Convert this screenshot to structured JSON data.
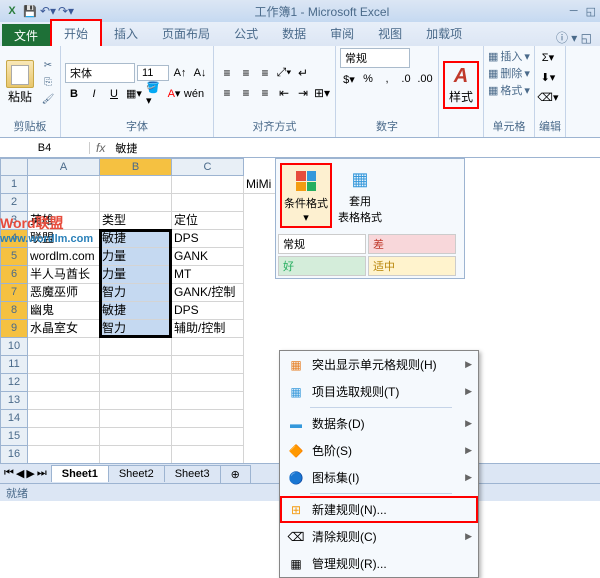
{
  "title": "工作簿1 - Microsoft Excel",
  "tabs": {
    "file": "文件",
    "home": "开始",
    "insert": "插入",
    "layout": "页面布局",
    "formulas": "公式",
    "data": "数据",
    "review": "审阅",
    "view": "视图",
    "addins": "加载项"
  },
  "ribbon": {
    "clipboard": {
      "label": "剪贴板",
      "paste": "粘贴"
    },
    "font": {
      "label": "字体",
      "name": "宋体",
      "size": "11"
    },
    "align": {
      "label": "对齐方式"
    },
    "number": {
      "label": "数字",
      "format": "常规"
    },
    "styles": {
      "label": "样式"
    },
    "cells": {
      "label": "单元格",
      "insert": "插入",
      "delete": "删除",
      "format": "格式"
    },
    "editing": {
      "label": "编辑"
    }
  },
  "namebox": "B4",
  "formula": "敏捷",
  "columns": [
    "A",
    "B",
    "C"
  ],
  "grid": [
    [
      "",
      "",
      "",
      "MiMi"
    ],
    [
      "",
      "",
      ""
    ],
    [
      "英雄",
      "类型",
      "定位"
    ],
    [
      "联盟",
      "敏捷",
      "DPS"
    ],
    [
      "wordlm.com",
      "力量",
      "GANK"
    ],
    [
      "半人马酋长",
      "力量",
      "MT"
    ],
    [
      "恶魔巫师",
      "智力",
      "GANK/控制"
    ],
    [
      "幽鬼",
      "敏捷",
      "DPS"
    ],
    [
      "水晶室女",
      "智力",
      "辅助/控制"
    ]
  ],
  "watermark": {
    "line1": "Word联盟",
    "line2": "www.wordlm.com"
  },
  "cf": {
    "cond_format": "条件格式",
    "table_format": "套用\n表格格式",
    "normal": "常规",
    "bad": "差",
    "good": "好",
    "neutral": "适中"
  },
  "dropdown": {
    "highlight": "突出显示单元格规则(H)",
    "top_bottom": "项目选取规则(T)",
    "data_bars": "数据条(D)",
    "color_scales": "色阶(S)",
    "icon_sets": "图标集(I)",
    "new_rule": "新建规则(N)...",
    "clear_rules": "清除规则(C)",
    "manage_rules": "管理规则(R)..."
  },
  "sheets": {
    "s1": "Sheet1",
    "s2": "Sheet2",
    "s3": "Sheet3"
  },
  "status": "就绪"
}
